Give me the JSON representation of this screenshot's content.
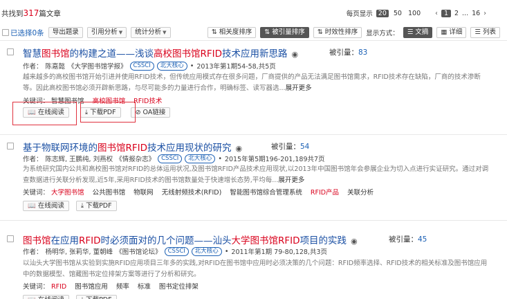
{
  "header": {
    "found_prefix": "共找到",
    "found_count": "317",
    "found_suffix": "篇文章",
    "page_size_label": "每页显示",
    "page_sizes": [
      "20",
      "50",
      "100"
    ],
    "page_prev": "‹",
    "page_current": "1",
    "page_next_num": "2",
    "page_ellipsis": "...",
    "page_last": "16",
    "page_next": "›"
  },
  "toolbar": {
    "selected": "已选择0条",
    "export": "导出题录",
    "cite_analysis": "引用分析",
    "stats_analysis": "统计分析",
    "sort_relevance": "相关度排序",
    "sort_citation": "被引量排序",
    "sort_timeliness": "时效性排序",
    "view_label": "显示方式：",
    "view_abstract": "文摘",
    "view_detail": "详细",
    "view_list": "列表"
  },
  "actions": {
    "read_online": "在线阅读",
    "download_pdf": "下载PDF",
    "oa_link": "OA链接"
  },
  "labels": {
    "authors_prefix": "作者：",
    "keywords_prefix": "关键词：",
    "cited_prefix": "被引量："
  },
  "results": [
    {
      "title_parts": [
        "智慧",
        "图书馆",
        "的构建之道——浅谈",
        "高校图书馆",
        "RFID",
        "技术应用新思路"
      ],
      "cited": "83",
      "authors": "陈嘉懿",
      "journal": "《大学图书馆学报》",
      "tags": [
        "CSSCI",
        "北大核心"
      ],
      "issue": "2013年第1期54-58,共5页",
      "abstract": "越来越多的高校图书馆开始引进并使用RFID技术，但传统应用模式存在很多问题，厂商提供的产品无法满足图书馆需求，RFID技术存在缺陷，厂商的技术渗断等。因此高校图书馆必须开辟新思路，与尽可能多的力量进行合作，明确标签、读写器选...",
      "more": "展开更多",
      "keywords": [
        "智慧图书馆",
        "高校图书馆",
        "RFID技术"
      ]
    },
    {
      "title_parts": [
        "基于物联网环境的",
        "图书馆",
        "RFID",
        "技术应用现状的研究"
      ],
      "cited": "54",
      "authors": "陈志辉, 王鹏纯, 刘燕权",
      "journal": "《情报杂志》",
      "tags": [
        "CSSCI",
        "北大核心"
      ],
      "issue": "2015年第5期196-201,189共7页",
      "abstract": "为系统研究国内公共和高校图书馆对RFID的总体运用状况,及图书馆RFID产品技术应用现状,以2013年中国图书馆年会参展企业为切入点进行实证研究。通过对调查数据进行关联分析发现,近5年,采用RFID技术的图书馆数量处于快速增长态势,平均每...",
      "more": "展开更多",
      "keywords": [
        "大学图书馆",
        "公共图书馆",
        "物联网",
        "无线射频技术(RFID)",
        "智能图书馆综合管理系统",
        "RFID产品",
        "关联分析"
      ]
    },
    {
      "title_parts": [
        "图书馆",
        "在应用",
        "RFID",
        "时必须面对的几个问题——汕头",
        "大学图书馆",
        "RFID",
        "项目的实践"
      ],
      "cited": "45",
      "authors": "杨明华, 张莉华, 董朝峰",
      "journal": "《图书馆论坛》",
      "tags": [
        "CSSCI",
        "北大核心"
      ],
      "issue": "2011年第1期 79-80,128,共3页",
      "abstract": "以汕头大学图书馆从实验到实施RFID应用项目三年多的实践,对RFID在图书馆中应用时必须决策的几个问题：RFID频率选择、RFID技术的相关标准及图书馆应用中的数据模型、馆藏图书定位排架方案等进行了分析和研究。",
      "more": "",
      "keywords": [
        "RFID",
        "图书馆应用",
        "频率",
        "标准",
        "图书定位排架"
      ]
    }
  ]
}
